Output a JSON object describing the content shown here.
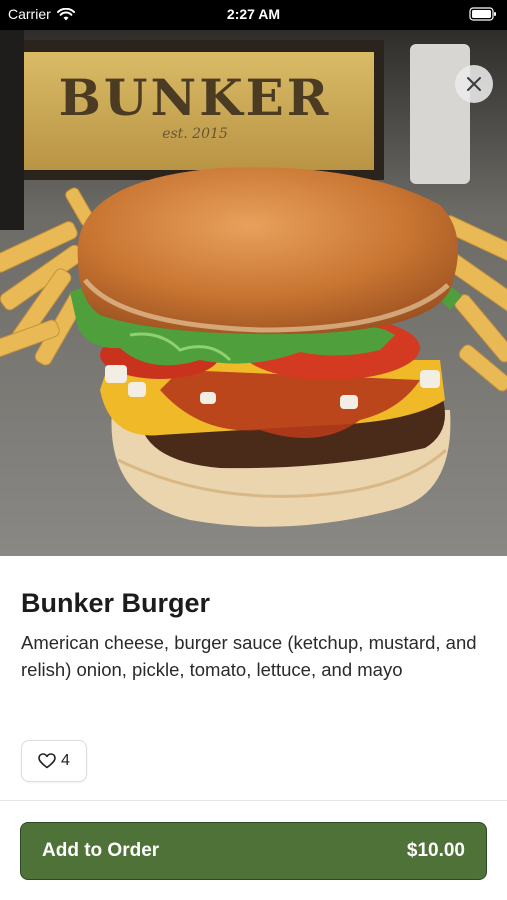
{
  "status_bar": {
    "carrier": "Carrier",
    "time": "2:27 AM"
  },
  "hero": {
    "sign_text": "BUNKER",
    "sign_subtext": "est. 2015"
  },
  "item": {
    "title": "Bunker Burger",
    "description": "American cheese, burger sauce (ketchup, mustard, and relish) onion, pickle, tomato, lettuce, and mayo",
    "like_count": "4"
  },
  "order_button": {
    "label": "Add to Order",
    "price": "$10.00"
  },
  "colors": {
    "accent": "#4f7238",
    "status_bar": "#000000"
  },
  "icons": [
    "wifi-icon",
    "battery-icon",
    "close-icon",
    "heart-icon"
  ]
}
